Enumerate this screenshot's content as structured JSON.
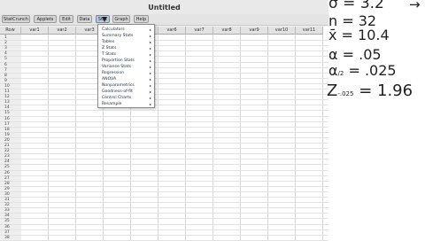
{
  "window": {
    "title": "Untitled"
  },
  "toolbar": [
    {
      "label": "StatCrunch",
      "active": false
    },
    {
      "label": "Applets",
      "active": false
    },
    {
      "label": "Edit",
      "active": false
    },
    {
      "label": "Data",
      "active": false
    },
    {
      "label": "Stat",
      "active": true
    },
    {
      "label": "Graph",
      "active": false
    },
    {
      "label": "Help",
      "active": false
    }
  ],
  "grid": {
    "row_header": "Row",
    "columns": [
      "var1",
      "var2",
      "var3",
      "var4",
      "var5",
      "var6",
      "var7",
      "var8",
      "var9",
      "var10",
      "var11"
    ],
    "rows": [
      "1",
      "2",
      "3",
      "4",
      "5",
      "6",
      "7",
      "8",
      "9",
      "10",
      "11",
      "12",
      "13",
      "14",
      "15",
      "16",
      "17",
      "18",
      "19",
      "20",
      "21",
      "22",
      "23",
      "24",
      "25",
      "26",
      "27",
      "28",
      "29",
      "30",
      "31",
      "32",
      "33",
      "34",
      "35",
      "36",
      "37",
      "38"
    ]
  },
  "stat_menu": [
    "Calculators",
    "Summary Stats",
    "Tables",
    "Z Stats",
    "T Stats",
    "Proportion Stats",
    "Variance Stats",
    "Regression",
    "ANOVA",
    "Nonparametrics",
    "Goodness-of-fit",
    "Control Charts",
    "Resample"
  ],
  "notes": {
    "sigma": "σ = 3.2",
    "n": "n = 32",
    "xbar": "x̄ = 10.4",
    "alpha": "α = .05",
    "alpha_half_main": "α",
    "alpha_half_sub": "/2",
    "alpha_half_val": " = .025",
    "z_main": "Z",
    "z_sub": "-.025",
    "z_val": " = 1.96",
    "arrow": "→"
  }
}
